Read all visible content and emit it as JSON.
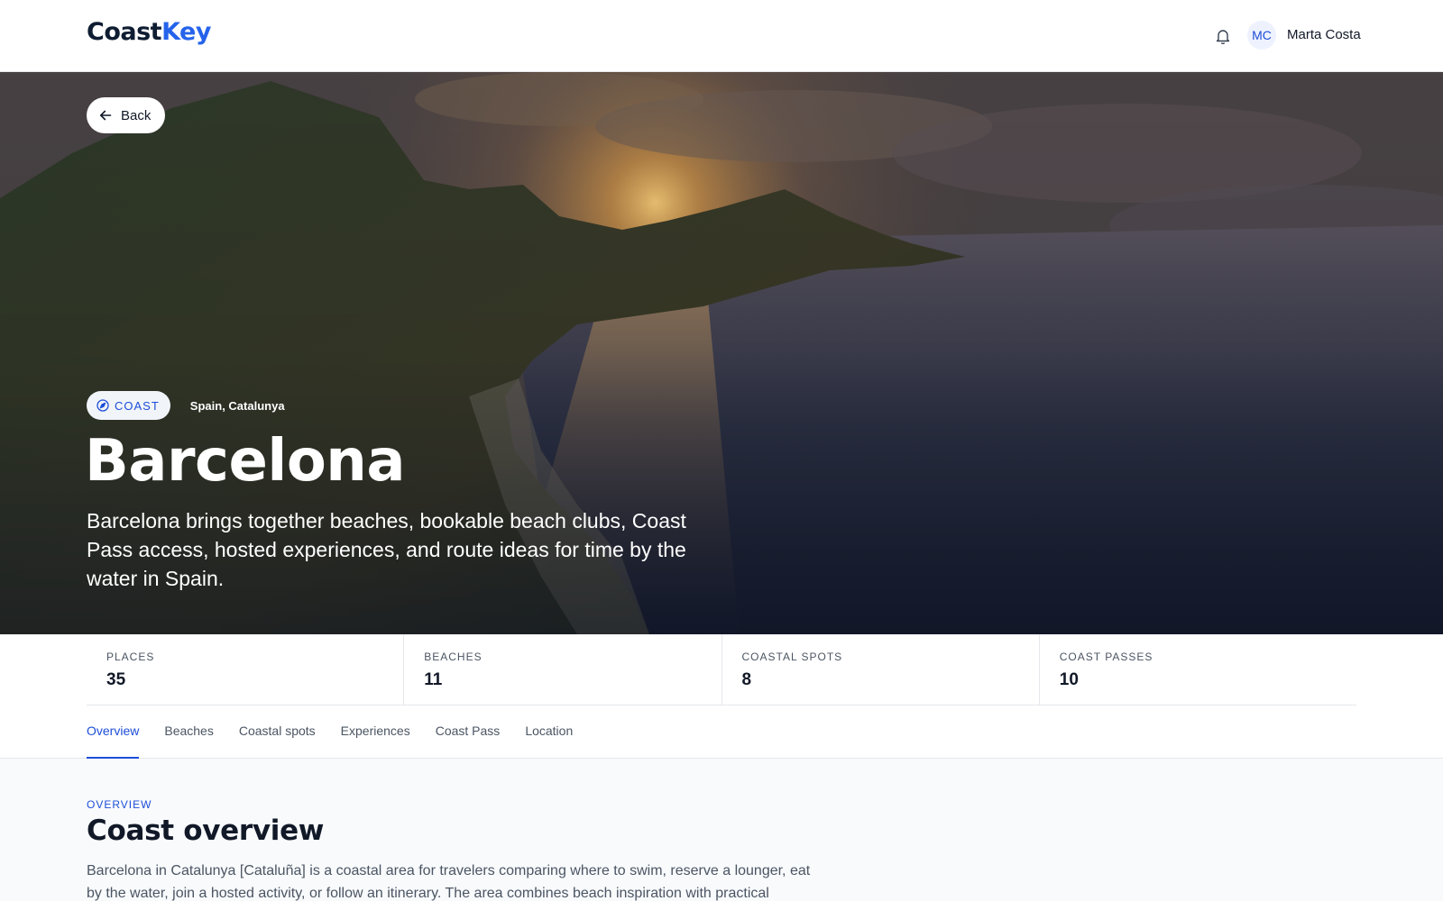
{
  "header": {
    "logo_primary": "Coast",
    "logo_accent": "Key",
    "notification_icon": "bell-icon",
    "avatar_initials": "MC",
    "user_name": "Marta Costa"
  },
  "hero": {
    "back_label": "Back",
    "badge_label": "COAST",
    "badge_icon": "compass-icon",
    "region": "Spain, Catalunya",
    "title": "Barcelona",
    "description": "Barcelona brings together beaches, bookable beach clubs, Coast Pass access, hosted experiences, and route ideas for time by the water in Spain."
  },
  "stats": [
    {
      "label": "PLACES",
      "value": "35"
    },
    {
      "label": "BEACHES",
      "value": "11"
    },
    {
      "label": "COASTAL SPOTS",
      "value": "8"
    },
    {
      "label": "COAST PASSES",
      "value": "10"
    }
  ],
  "tabs": [
    {
      "label": "Overview",
      "active": true
    },
    {
      "label": "Beaches"
    },
    {
      "label": "Coastal spots"
    },
    {
      "label": "Experiences"
    },
    {
      "label": "Coast Pass"
    },
    {
      "label": "Location"
    }
  ],
  "overview": {
    "eyebrow": "OVERVIEW",
    "title": "Coast overview",
    "body": "Barcelona in Catalunya [Cataluña] is a coastal area for travelers comparing where to swim, reserve a lounger, eat by the water, join a hosted activity, or follow an itinerary. The area combines beach inspiration with practical"
  },
  "colors": {
    "accent": "#1d4ed8",
    "logo_accent": "#2563eb",
    "text_dark": "#111827",
    "page_bg": "#f8fafc"
  }
}
